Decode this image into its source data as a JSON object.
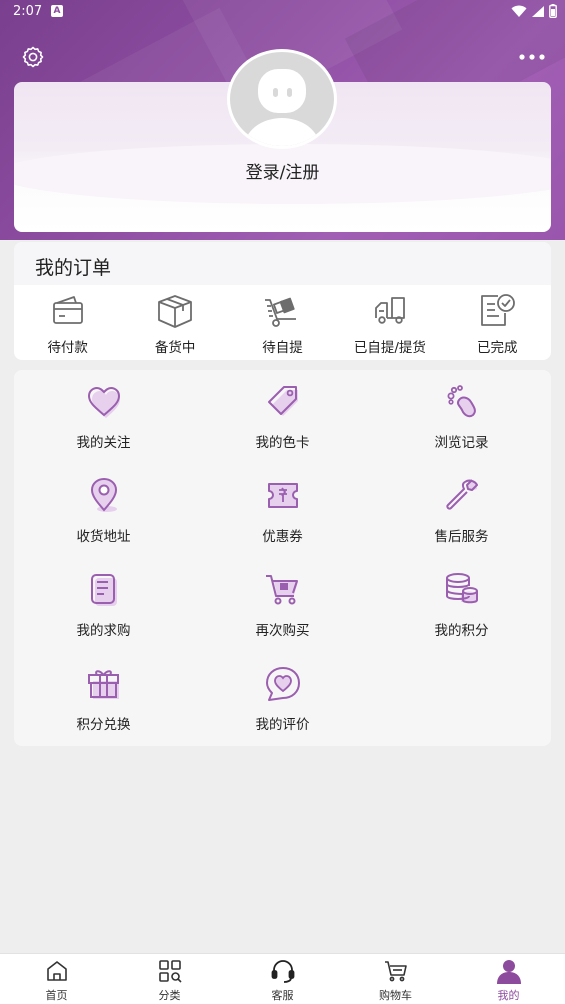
{
  "status_bar": {
    "time": "2:07",
    "notification_badge": "A"
  },
  "header": {
    "settings_icon": "settings-icon",
    "more_icon": "more-dots-icon"
  },
  "profile": {
    "login_label": "登录/注册"
  },
  "orders": {
    "title": "我的订单",
    "items": [
      {
        "label": "待付款",
        "icon": "wallet-icon"
      },
      {
        "label": "备货中",
        "icon": "package-box-icon"
      },
      {
        "label": "待自提",
        "icon": "hand-truck-icon"
      },
      {
        "label": "已自提/提货",
        "icon": "delivery-truck-icon"
      },
      {
        "label": "已完成",
        "icon": "completed-document-icon"
      }
    ]
  },
  "services": {
    "items": [
      {
        "label": "我的关注",
        "icon": "heart-icon"
      },
      {
        "label": "我的色卡",
        "icon": "tag-icon"
      },
      {
        "label": "浏览记录",
        "icon": "footprint-icon"
      },
      {
        "label": "收货地址",
        "icon": "location-pin-icon"
      },
      {
        "label": "优惠券",
        "icon": "coupon-icon"
      },
      {
        "label": "售后服务",
        "icon": "wrench-icon"
      },
      {
        "label": "我的求购",
        "icon": "document-icon"
      },
      {
        "label": "再次购买",
        "icon": "shopping-cart-icon"
      },
      {
        "label": "我的积分",
        "icon": "coins-icon"
      },
      {
        "label": "积分兑换",
        "icon": "gift-icon"
      },
      {
        "label": "我的评价",
        "icon": "comment-heart-icon"
      }
    ]
  },
  "tabbar": {
    "active": "我的",
    "items": [
      {
        "label": "首页",
        "icon": "home-icon"
      },
      {
        "label": "分类",
        "icon": "category-grid-icon"
      },
      {
        "label": "客服",
        "icon": "headset-icon"
      },
      {
        "label": "购物车",
        "icon": "cart-icon"
      },
      {
        "label": "我的",
        "icon": "person-icon"
      }
    ]
  },
  "colors": {
    "brand": "#8d4b9e",
    "icon_fill": "#e7d0ee",
    "icon_stroke": "#9a5fae",
    "order_icon": "#6d6d6d"
  }
}
